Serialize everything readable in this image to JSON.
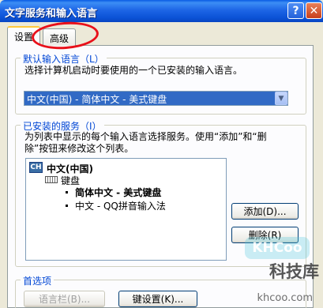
{
  "window": {
    "title": "文字服务和输入语言",
    "help_button": "?",
    "close_button": "✕"
  },
  "tabs": [
    {
      "label": "设置",
      "selected": true
    },
    {
      "label": "高级",
      "selected": false
    }
  ],
  "default_language": {
    "group_title": "默认输入语言（L）",
    "description": "选择计算机启动时要使用的一个已安装的输入语言。",
    "selected_value": "中文(中国) - 简体中文 - 美式键盘"
  },
  "installed_services": {
    "group_title": "已安装的服务（I）",
    "description_line1": "为列表中显示的每个输入语言选择服务。使用“添加”和“删",
    "description_line2": "除”按钮来修改这个列表。",
    "language_badge": "CH",
    "language": "中文(中国)",
    "category": "键盘",
    "services": [
      {
        "label": "简体中文 - 美式键盘",
        "bold": true
      },
      {
        "label": "中文 - QQ拼音输入法",
        "bold": false
      }
    ],
    "add_button": "添加(D)...",
    "delete_button": "删除(R)"
  },
  "preferences": {
    "group_title": "首选项",
    "language_bar_button": "语言栏(B)...",
    "key_settings_button": "键设置(K)..."
  },
  "watermark": {
    "logo": "KHCoo",
    "name": "科技库",
    "url": "khcoo.com"
  },
  "accent_colors": {
    "titlebar": "#0b52d6",
    "selection": "#316ac5",
    "group_title": "#0046d5",
    "annotation_circle": "#e8101a"
  }
}
